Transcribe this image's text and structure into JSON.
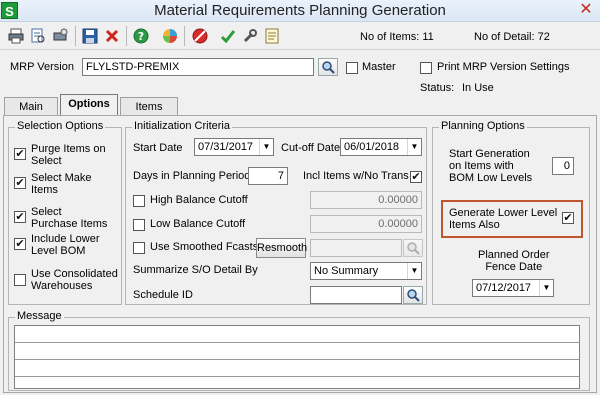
{
  "window": {
    "title": "Material Requirements Planning Generation",
    "logo_letter": "S",
    "close_glyph": "✕"
  },
  "toolbar": {
    "items_label": "No of Items: 11",
    "detail_label": "No of Detail: 72",
    "icons": [
      "printer-icon",
      "print-preview-icon",
      "print-setup-icon",
      "save-icon",
      "delete-icon",
      "help-icon",
      "colors-icon",
      "cancel-icon",
      "accept-icon",
      "tools-icon",
      "memo-icon"
    ]
  },
  "header": {
    "mrp_version_label": "MRP Version",
    "mrp_version_value": "FLYLSTD-PREMIX",
    "master_label": "Master",
    "print_settings_label": "Print MRP Version Settings",
    "status_label": "Status:",
    "status_value": "In Use"
  },
  "tabs": [
    {
      "label": "Main"
    },
    {
      "label": "Options"
    },
    {
      "label": "Items"
    }
  ],
  "selection_options": {
    "title": "Selection Options",
    "items": [
      {
        "line1": "Purge Items on",
        "line2": "Select",
        "checked": true
      },
      {
        "line1": "Select Make",
        "line2": "Items",
        "checked": true
      },
      {
        "line1": "Select",
        "line2": "Purchase Items",
        "checked": true
      },
      {
        "line1": "Include Lower",
        "line2": "Level BOM",
        "checked": true
      },
      {
        "line1": "Use Consolidated",
        "line2": "Warehouses",
        "checked": false
      }
    ]
  },
  "init_criteria": {
    "title": "Initialization Criteria",
    "start_date_label": "Start Date",
    "start_date": "07/31/2017",
    "cutoff_label": "Cut-off Date",
    "cutoff_date": "06/01/2018",
    "days_label": "Days in Planning Period",
    "days_value": "7",
    "incl_no_trans_label": "Incl Items w/No Trans",
    "incl_no_trans_checked": true,
    "high_balance_label": "High Balance Cutoff",
    "high_balance_value": "0.00000",
    "low_balance_label": "Low Balance Cutoff",
    "low_balance_value": "0.00000",
    "smoothed_label": "Use Smoothed Fcasts",
    "resmooth_label": "Resmooth",
    "summarize_label": "Summarize S/O Detail By",
    "summarize_value": "No Summary",
    "schedule_label": "Schedule ID",
    "schedule_value": ""
  },
  "planning_options": {
    "title": "Planning Options",
    "start_gen_line1": "Start Generation",
    "start_gen_line2": "on Items with",
    "start_gen_line3": "BOM Low Levels",
    "start_gen_value": "0",
    "gen_lower_line1": "Generate Lower Level",
    "gen_lower_line2": "Items  Also",
    "gen_lower_checked": true,
    "fence_line1": "Planned Order",
    "fence_line2": "Fence Date",
    "fence_date": "07/12/2017"
  },
  "message": {
    "title": "Message"
  }
}
